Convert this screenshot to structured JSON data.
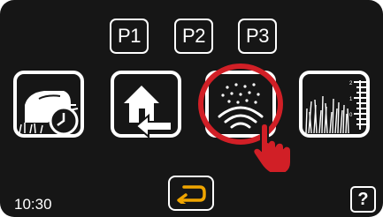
{
  "presets": [
    {
      "label": "P1"
    },
    {
      "label": "P2"
    },
    {
      "label": "P3"
    }
  ],
  "menu_tiles": [
    {
      "icon": "schedule-mower-clock-icon"
    },
    {
      "icon": "return-to-station-icon"
    },
    {
      "icon": "rain-sensor-icon",
      "highlighted": true
    },
    {
      "icon": "cutting-height-icon"
    }
  ],
  "cutting_height_scale": [
    "2",
    "1",
    "0"
  ],
  "status": {
    "time": "10:30"
  },
  "buttons": {
    "back_icon": "back-arrow-icon",
    "help_label": "?"
  },
  "colors": {
    "background": "#161616",
    "foreground": "#ffffff",
    "highlight": "#d11f26"
  }
}
